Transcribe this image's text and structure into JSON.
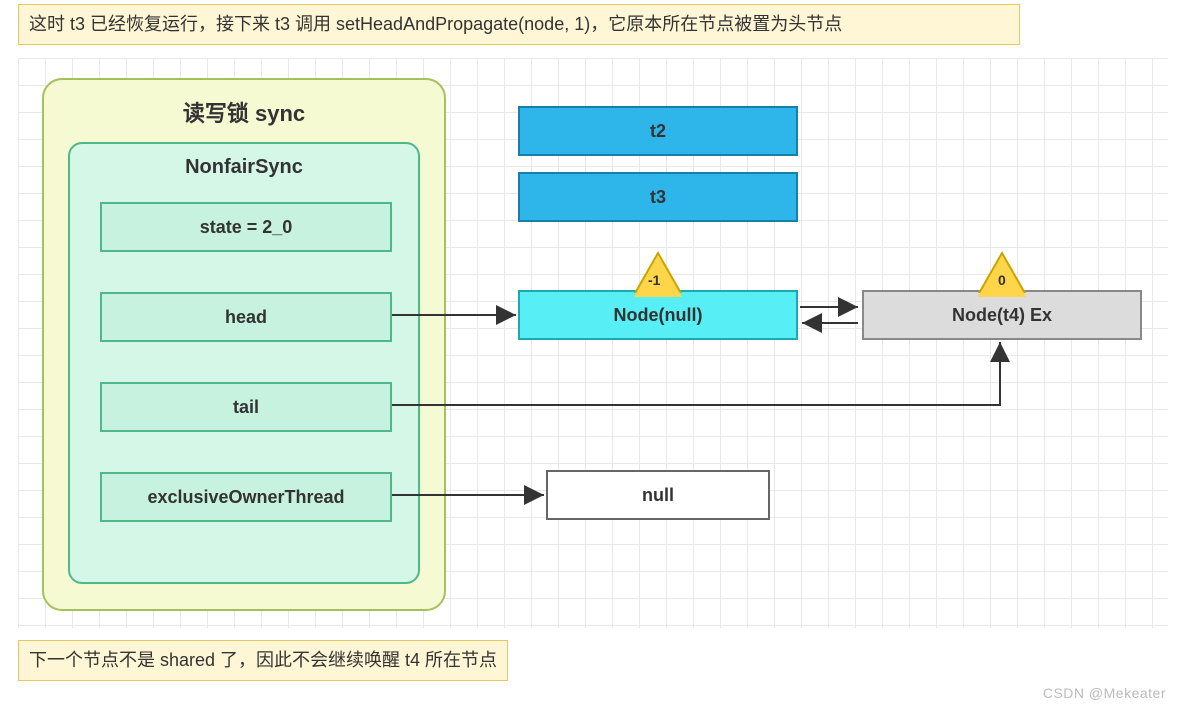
{
  "notes": {
    "top": "这时 t3 已经恢复运行，接下来 t3 调用 setHeadAndPropagate(node, 1)，它原本所在节点被置为头节点",
    "bottom": "下一个节点不是 shared 了，因此不会继续唤醒 t4 所在节点"
  },
  "outer": {
    "title": "读写锁 sync"
  },
  "inner": {
    "title": "NonfairSync",
    "fields": {
      "state": "state = 2_0",
      "head": "head",
      "tail": "tail",
      "eot": "exclusiveOwnerThread"
    }
  },
  "threads": {
    "t2": "t2",
    "t3": "t3"
  },
  "nodes": {
    "head": "Node(null)",
    "ex": "Node(t4) Ex",
    "null": "null"
  },
  "triangles": {
    "left": "-1",
    "right": "0"
  },
  "watermark": "CSDN @Mekeater"
}
